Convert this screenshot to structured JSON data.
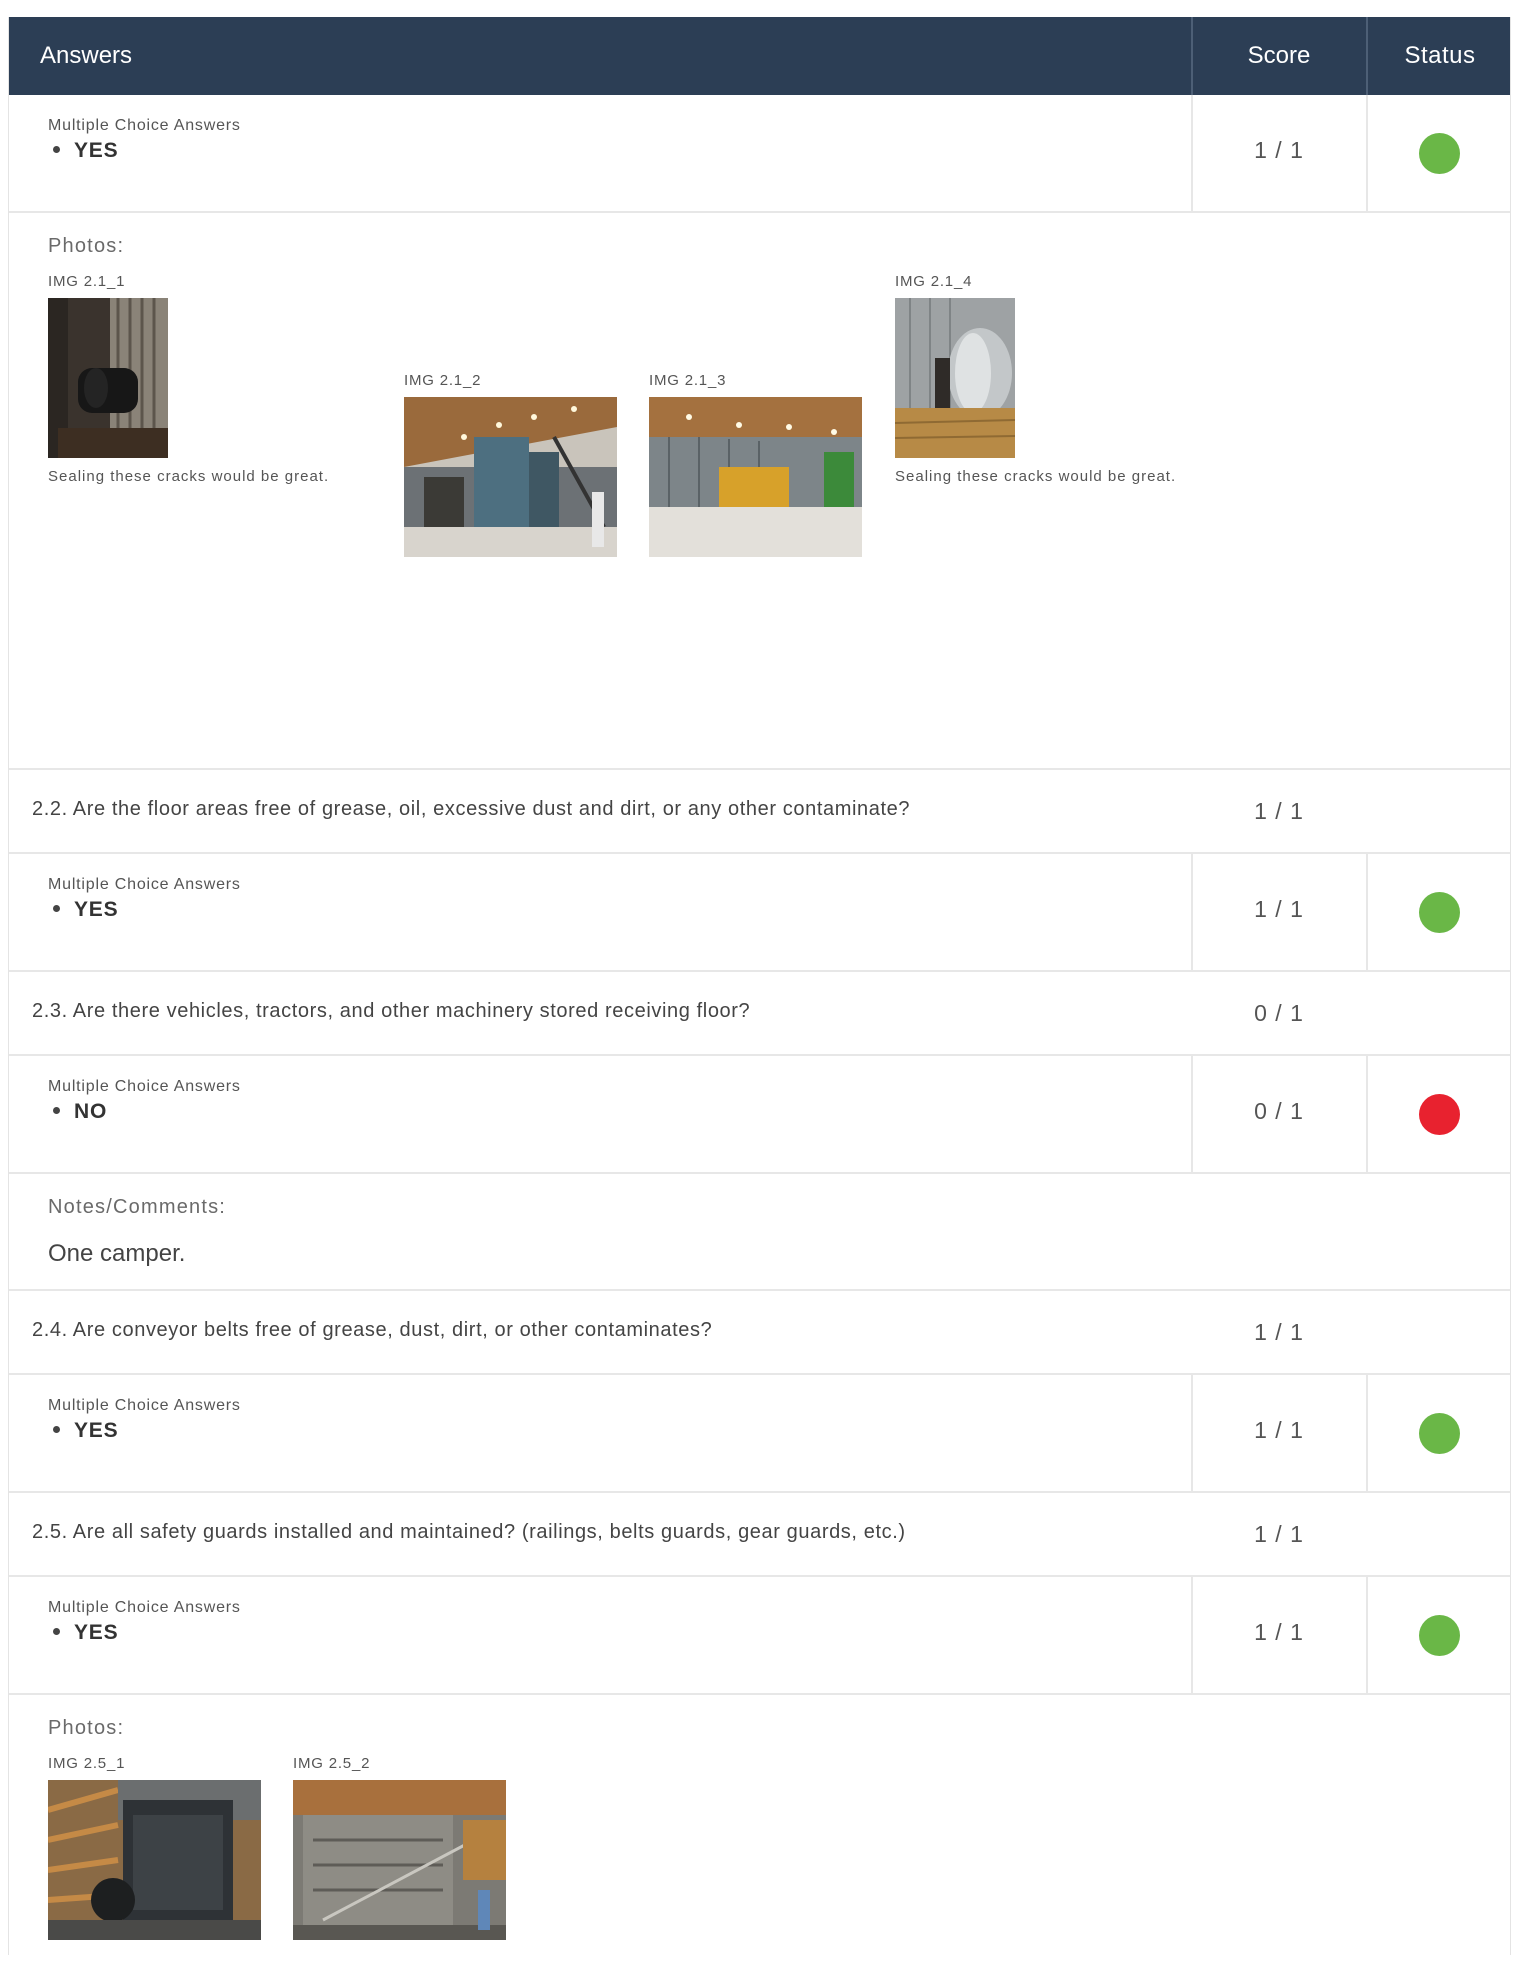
{
  "header": {
    "answers": "Answers",
    "score": "Score",
    "status": "Status"
  },
  "mc_label": "Multiple Choice Answers",
  "photos_title": "Photos:",
  "notes_title": "Notes/Comments:",
  "colors": {
    "header_bg": "#2c3e55",
    "pass": "#6ab747",
    "fail": "#e8222f"
  },
  "q21": {
    "answer": "YES",
    "score": "1 / 1",
    "status": "pass",
    "photos": [
      {
        "label": "IMG 2.1_1",
        "caption": "Sealing these cracks would be great."
      },
      {
        "label": "IMG 2.1_2",
        "caption": ""
      },
      {
        "label": "IMG 2.1_3",
        "caption": ""
      },
      {
        "label": "IMG 2.1_4",
        "caption": "Sealing these cracks would be great."
      }
    ]
  },
  "q22": {
    "question": "2.2.  Are the floor areas free of grease, oil, excessive dust and dirt, or any other contaminate?",
    "question_score": "1 / 1",
    "answer": "YES",
    "score": "1 / 1",
    "status": "pass"
  },
  "q23": {
    "question": "2.3.  Are there vehicles, tractors, and other machinery stored receiving floor?",
    "question_score": "0 / 1",
    "answer": "NO",
    "score": "0 / 1",
    "status": "fail",
    "notes": "One camper."
  },
  "q24": {
    "question": "2.4.  Are conveyor belts free of grease, dust, dirt, or other contaminates?",
    "question_score": "1 / 1",
    "answer": "YES",
    "score": "1 / 1",
    "status": "pass"
  },
  "q25": {
    "question": "2.5.  Are all safety guards installed and maintained? (railings, belts guards, gear guards, etc.)",
    "question_score": "1 / 1",
    "answer": "YES",
    "score": "1 / 1",
    "status": "pass",
    "photos": [
      {
        "label": "IMG 2.5_1"
      },
      {
        "label": "IMG 2.5_2"
      }
    ]
  }
}
